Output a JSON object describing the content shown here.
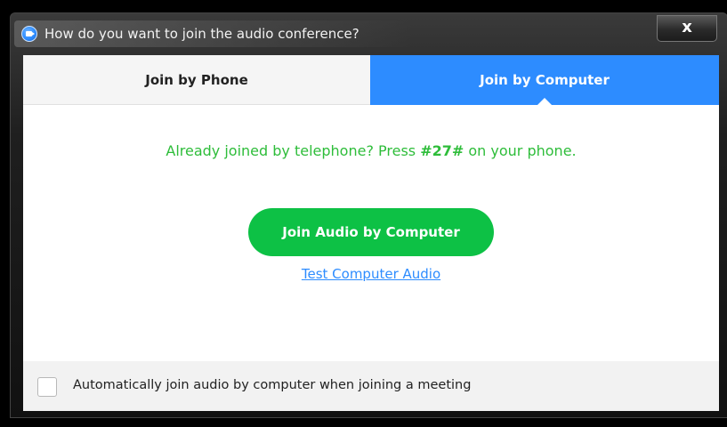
{
  "window": {
    "title": "How do you want to join the audio conference?",
    "close_label": "x"
  },
  "tabs": [
    {
      "label": "Join by Phone",
      "active": false
    },
    {
      "label": "Join by Computer",
      "active": true
    }
  ],
  "info": {
    "prefix": "Already joined by telephone? Press ",
    "code": "#27#",
    "suffix": " on your phone."
  },
  "main": {
    "join_button_label": "Join Audio by Computer",
    "test_link_label": "Test Computer Audio"
  },
  "footer": {
    "checkbox_label": "Automatically join audio by computer when joining a meeting",
    "checked": false
  },
  "colors": {
    "accent": "#2d8cff",
    "join_green": "#0dc145",
    "info_green": "#2ebd3a"
  },
  "icons": {
    "app": "zoom-camera-icon",
    "close": "close-icon"
  }
}
